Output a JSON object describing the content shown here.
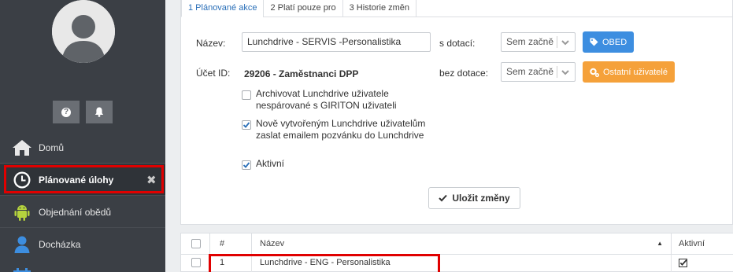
{
  "sidebar": {
    "help_label": "?",
    "nav_items": [
      {
        "label": "Domů",
        "icon": "home-icon"
      },
      {
        "label": "Plánované úlohy",
        "icon": "clock-icon",
        "active": true
      },
      {
        "label": "Objednání obědů",
        "icon": "android-icon"
      },
      {
        "label": "Docházka",
        "icon": "user-icon"
      }
    ],
    "close_label": "✖"
  },
  "tabs": [
    {
      "label": "1 Plánované akce",
      "active": true
    },
    {
      "label": "2 Platí pouze pro"
    },
    {
      "label": "3 Historie změn"
    }
  ],
  "form": {
    "name_label": "Název:",
    "name_value": "Lunchdrive - SERVIS -Personalistika",
    "account_label": "Účet ID:",
    "account_value": "29206 - Zaměstnanci DPP",
    "with_subsidy_label": "s dotací:",
    "with_subsidy_value": "Sem začně",
    "without_subsidy_label": "bez dotace:",
    "without_subsidy_value": "Sem začně",
    "obed_button": "OBED",
    "other_users_button": "Ostatní uživatelé",
    "checkboxes": [
      {
        "label": "Archivovat Lunchdrive uživatele nespárované s GIRITON uživateli",
        "checked": false
      },
      {
        "label": "Nově vytvořeným Lunchdrive uživatelům zaslat emailem pozvánku do Lunchdrive",
        "checked": true
      },
      {
        "label": "Aktivní",
        "checked": true
      }
    ],
    "save_button": "Uložit změny"
  },
  "table": {
    "columns": [
      "#",
      "Název",
      "Aktivní"
    ],
    "rows": [
      {
        "num": "1",
        "name": "Lunchdrive - ENG - Personalistika",
        "active": true
      }
    ]
  },
  "colors": {
    "sidebar_bg": "#3b3f45",
    "highlight": "#e00000",
    "blue_button": "#3d8ee0",
    "orange_button": "#f5a13a",
    "tab_active": "#2a6fb8"
  }
}
